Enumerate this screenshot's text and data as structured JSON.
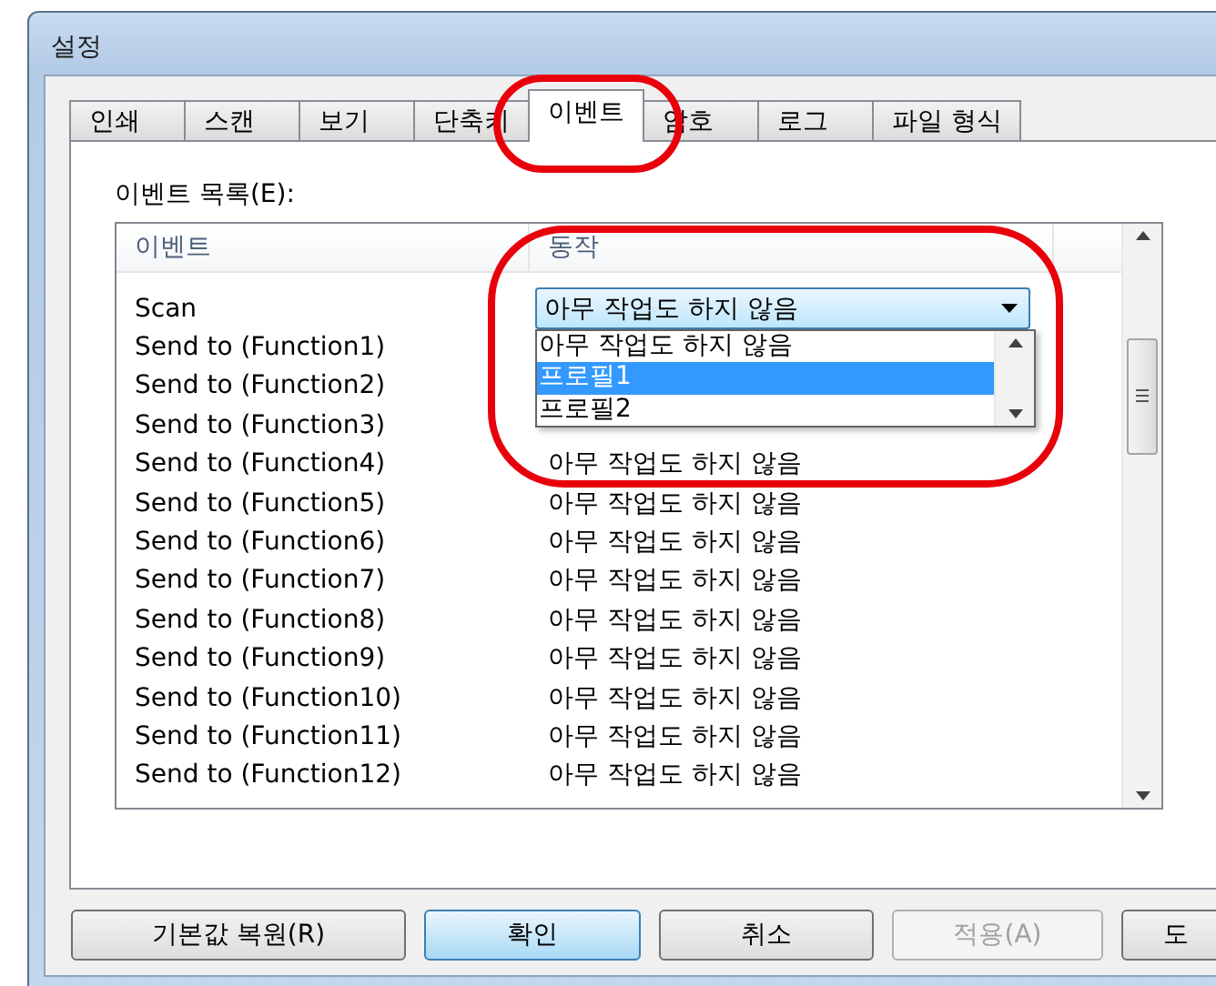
{
  "window": {
    "title": "설정"
  },
  "tabs": [
    {
      "label": "인쇄",
      "selected": false
    },
    {
      "label": "스캔",
      "selected": false
    },
    {
      "label": "보기",
      "selected": false
    },
    {
      "label": "단축키",
      "selected": false
    },
    {
      "label": "이벤트",
      "selected": true
    },
    {
      "label": "암호",
      "selected": false
    },
    {
      "label": "로그",
      "selected": false
    },
    {
      "label": "파일 형식",
      "selected": false
    }
  ],
  "event_list": {
    "label": "이벤트 목록(E):",
    "columns": [
      "이벤트",
      "동작"
    ],
    "rows": [
      {
        "kind": "dropdown",
        "event": "Scan",
        "action": "아무 작업도 하지 않음"
      },
      {
        "kind": "text",
        "event": "Send to (Function1)"
      },
      {
        "kind": "text",
        "event": "Send to (Function2)"
      },
      {
        "kind": "text",
        "event": "Send to (Function3)"
      },
      {
        "kind": "text",
        "event": "Send to (Function4)",
        "action": "아무 작업도 하지 않음"
      },
      {
        "kind": "text",
        "event": "Send to (Function5)",
        "action": "아무 작업도 하지 않음"
      },
      {
        "kind": "text",
        "event": "Send to (Function6)",
        "action": "아무 작업도 하지 않음"
      },
      {
        "kind": "text",
        "event": "Send to (Function7)",
        "action": "아무 작업도 하지 않음"
      },
      {
        "kind": "text",
        "event": "Send to (Function8)",
        "action": "아무 작업도 하지 않음"
      },
      {
        "kind": "text",
        "event": "Send to (Function9)",
        "action": "아무 작업도 하지 않음"
      },
      {
        "kind": "text",
        "event": "Send to (Function10)",
        "action": "아무 작업도 하지 않음"
      },
      {
        "kind": "text",
        "event": "Send to (Function11)",
        "action": "아무 작업도 하지 않음"
      },
      {
        "kind": "text",
        "event": "Send to (Function12)",
        "action": "아무 작업도 하지 않음"
      }
    ]
  },
  "dropdown_options": [
    {
      "label": "아무 작업도 하지 않음",
      "selected": false
    },
    {
      "label": "프로필1",
      "selected": true
    },
    {
      "label": "프로필2",
      "selected": false
    }
  ],
  "buttons": [
    {
      "label": "기본값 복원(R)",
      "default": false,
      "disabled": false
    },
    {
      "label": "확인",
      "default": true,
      "disabled": false
    },
    {
      "label": "취소",
      "default": false,
      "disabled": false
    },
    {
      "label": "적용(A)",
      "default": false,
      "disabled": true
    },
    {
      "label": "도",
      "default": false,
      "disabled": false
    }
  ]
}
